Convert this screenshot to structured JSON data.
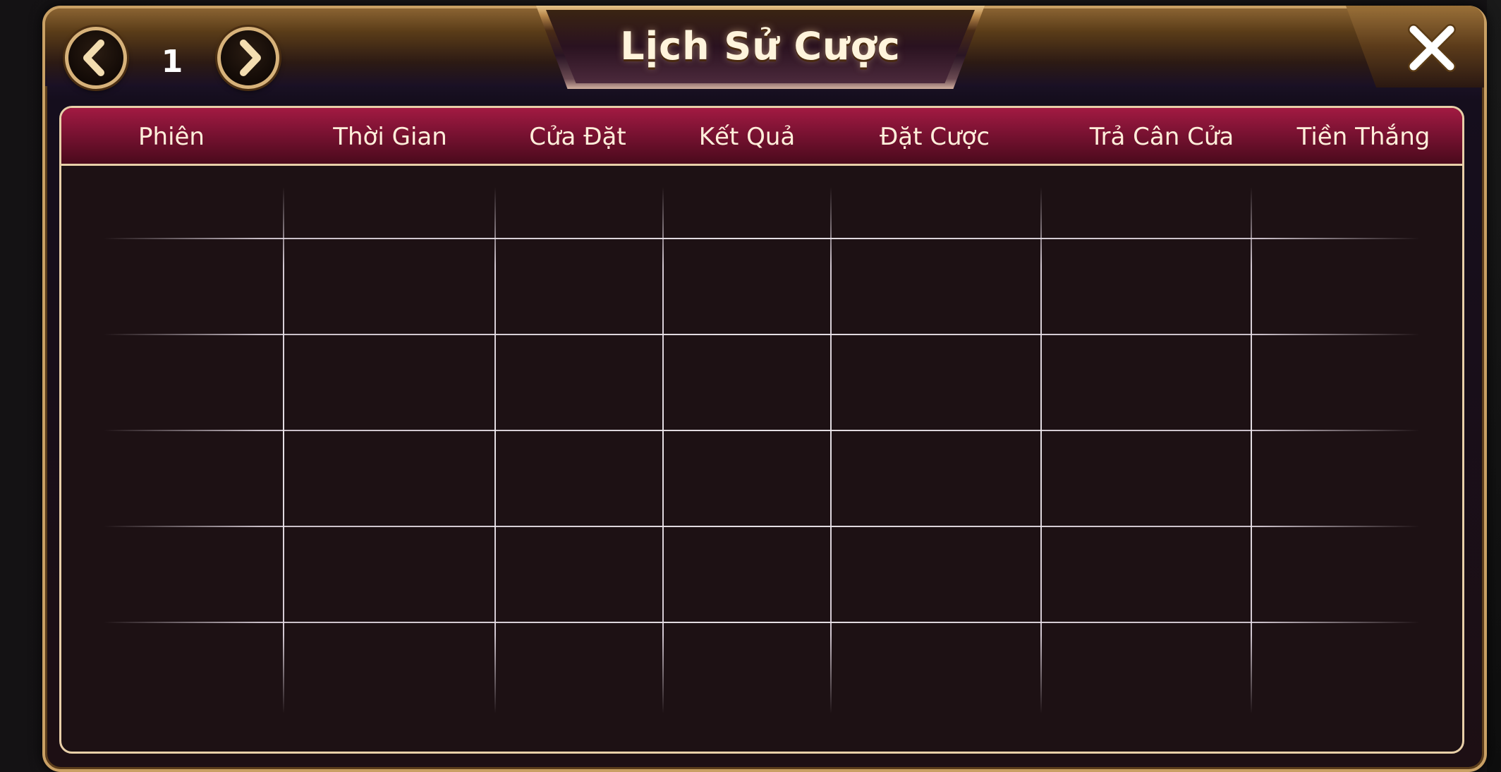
{
  "dialog": {
    "title": "Lịch Sử Cược",
    "page_number": "1",
    "prev_icon": "chevron-left-icon",
    "next_icon": "chevron-right-icon",
    "close_icon": "close-icon"
  },
  "table": {
    "columns": [
      {
        "label": "Phiên"
      },
      {
        "label": "Thời Gian"
      },
      {
        "label": "Cửa Đặt"
      },
      {
        "label": "Kết Quả"
      },
      {
        "label": "Đặt Cược"
      },
      {
        "label": "Trả Cân Cửa"
      },
      {
        "label": "Tiền Thắng"
      }
    ],
    "rows": [
      [
        "",
        "",
        "",
        "",
        "",
        "",
        ""
      ],
      [
        "",
        "",
        "",
        "",
        "",
        "",
        ""
      ],
      [
        "",
        "",
        "",
        "",
        "",
        "",
        ""
      ],
      [
        "",
        "",
        "",
        "",
        "",
        "",
        ""
      ],
      [
        "",
        "",
        "",
        "",
        "",
        "",
        ""
      ],
      [
        "",
        "",
        "",
        "",
        "",
        "",
        ""
      ]
    ]
  },
  "colors": {
    "accent_gold": "#d7b27a",
    "header_red": "#7a1232",
    "body_bg": "#1d1114",
    "text_light": "#ffeeda"
  }
}
